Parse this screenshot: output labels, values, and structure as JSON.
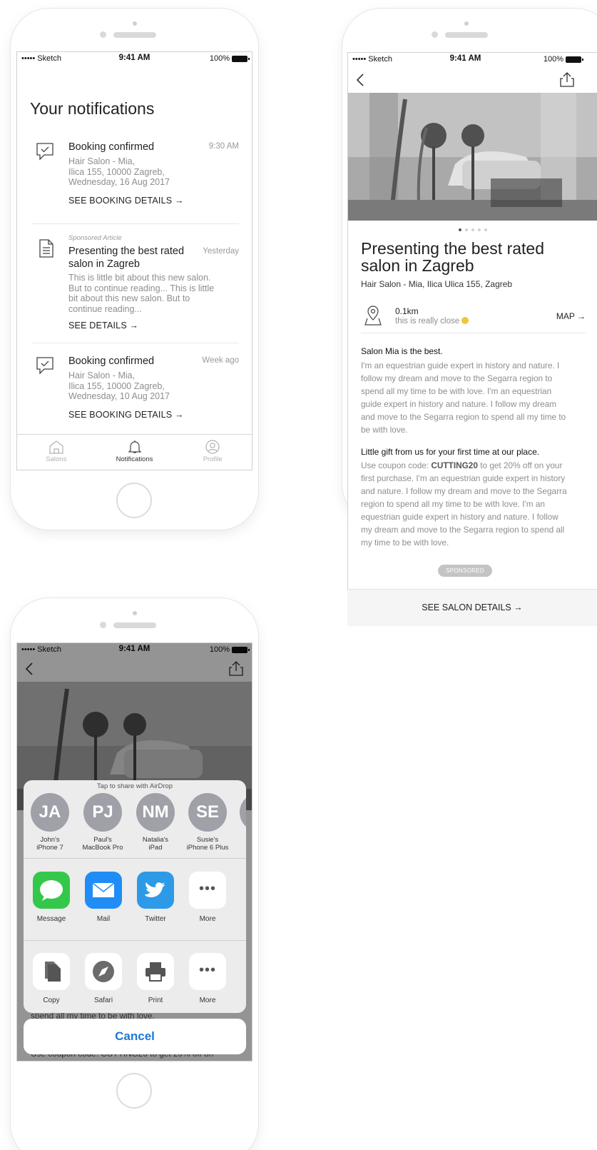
{
  "status": {
    "carrier": "••••• Sketch",
    "time": "9:41 AM",
    "battery": "100%"
  },
  "notifications_screen": {
    "title": "Your notifications",
    "items": [
      {
        "icon": "chat-check-icon",
        "title": "Booking confirmed",
        "time": "9:30 AM",
        "body": "Hair Salon - Mia,\nIlica 155, 10000 Zagreb,\nWednesday, 16 Aug 2017",
        "link": "SEE BOOKING DETAILS →"
      },
      {
        "icon": "document-icon",
        "kicker": "Sponsored Article",
        "title": "Presenting the best rated\nsalon in Zagreb",
        "time": "Yesterday",
        "body": "This is little bit about this new salon.\nBut to continue reading... This is little\nbit about this new salon. But to\ncontinue reading...",
        "link": "SEE DETAILS →"
      },
      {
        "icon": "chat-check-icon",
        "title": "Booking confirmed",
        "time": "Week ago",
        "body": "Hair Salon - Mia,\nIlica 155, 10000 Zagreb,\nWednesday, 10 Aug 2017",
        "link": "SEE BOOKING DETAILS →"
      }
    ],
    "tabs": [
      {
        "label": "Salons",
        "icon": "home-icon",
        "active": false
      },
      {
        "label": "Notifications",
        "icon": "bell-icon",
        "active": true
      },
      {
        "label": "Profile",
        "icon": "profile-icon",
        "active": false
      }
    ]
  },
  "article_screen": {
    "title": "Presenting the best rated salon in Zagreb",
    "subtitle": "Hair Salon - Mia, Ilica Ulica 155, Zagreb",
    "distance": "0.1km",
    "distance_note": "this is really close",
    "map_link": "MAP →",
    "carousel_pages": 5,
    "carousel_active": 1,
    "section1_heading": "Salon Mia is the best.",
    "section1_body": "I'm an equestrian guide expert in history and nature. I follow my dream and move to the Segarra region to spend all my time to be with love. I'm an equestrian guide expert in history and nature. I follow my dream and move to the Segarra region to spend all my time to be with love.",
    "section2_heading": "Little gift from us for your first time at our place.",
    "section2_body_pre": "Use coupon code: ",
    "coupon_code": "CUTTING20",
    "section2_body_post": " to get 20% off on your first purchase. I'm an equestrian guide expert in history and nature. I follow my dream and move to the Segarra region to spend all my time to be with love. I'm an equestrian guide expert in history and nature. I follow my dream and move to the Segarra region to spend all my time to be with love.",
    "badge": "SPONSORED",
    "cta": "SEE SALON DETAILS →"
  },
  "share_sheet": {
    "airdrop_label": "Tap to share with AirDrop",
    "people": [
      {
        "initials": "JA",
        "name": "John's\niPhone 7"
      },
      {
        "initials": "PJ",
        "name": "Paul's\nMacBook Pro"
      },
      {
        "initials": "NM",
        "name": "Natalia's\niPad"
      },
      {
        "initials": "SE",
        "name": "Susie's\niPhone 6 Plus"
      }
    ],
    "apps": [
      {
        "label": "Message",
        "icon": "message-icon",
        "color": "#34c84a"
      },
      {
        "label": "Mail",
        "icon": "mail-icon",
        "color": "#1f8df5"
      },
      {
        "label": "Twitter",
        "icon": "twitter-icon",
        "color": "#2d9ae8"
      },
      {
        "label": "More",
        "icon": "more-icon",
        "color": "#ffffff"
      }
    ],
    "actions": [
      {
        "label": "Copy",
        "icon": "copy-icon"
      },
      {
        "label": "Safari",
        "icon": "safari-icon"
      },
      {
        "label": "Print",
        "icon": "print-icon"
      },
      {
        "label": "More",
        "icon": "more-icon"
      }
    ],
    "cancel": "Cancel",
    "behind_text_1": "spend all my time to be with love.",
    "behind_text_2": "Use coupon code: CUTTING20 to get 20% off on"
  },
  "colors": {
    "accent": "#1c78d9",
    "muted_text": "#8e8e8e",
    "avatar": "#9fa0a8"
  }
}
